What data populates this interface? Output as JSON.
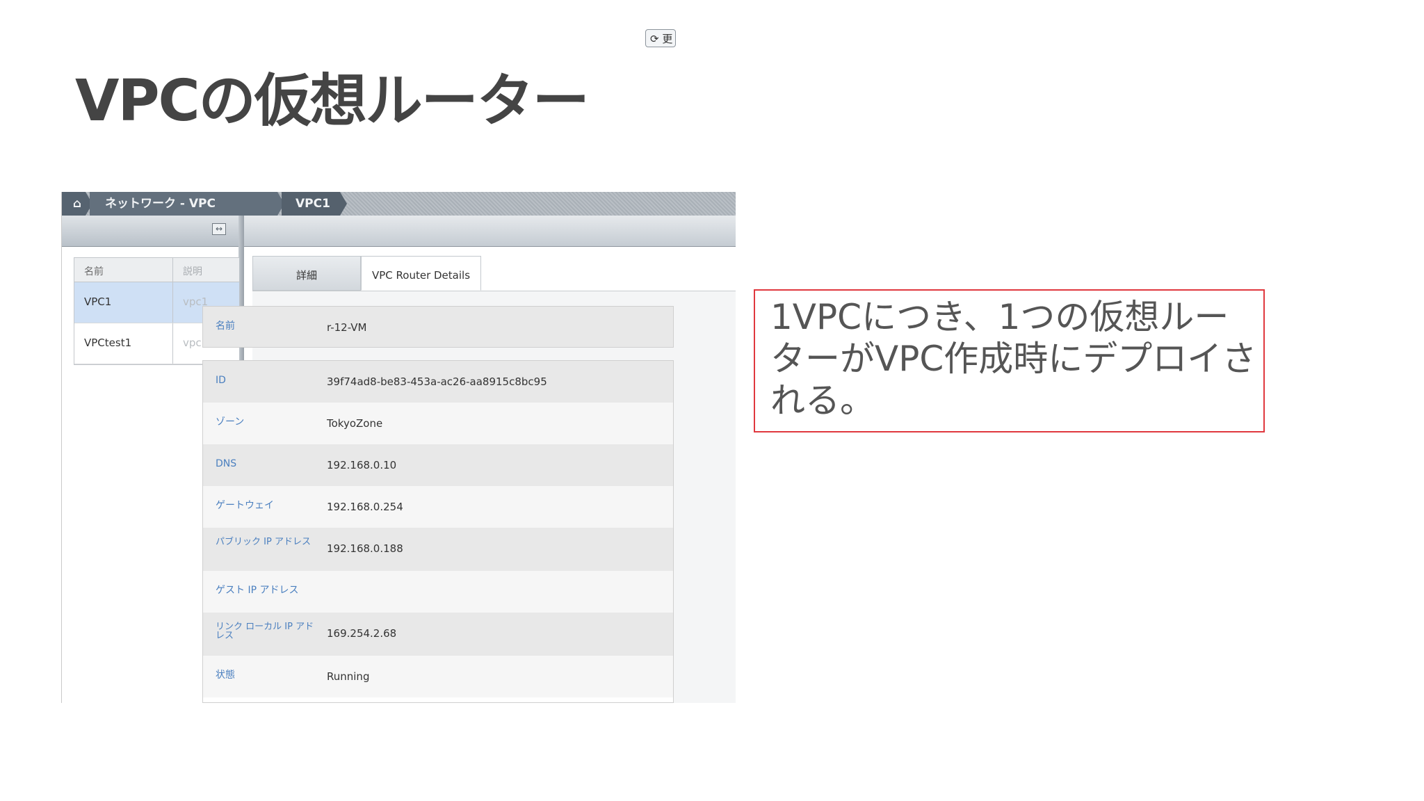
{
  "slide": {
    "title": "VPCの仮想ルーター"
  },
  "breadcrumb": {
    "home": "home-icon",
    "section": "ネットワーク - VPC",
    "current": "VPC1"
  },
  "toolbar": {
    "refresh_label": "更"
  },
  "list": {
    "headers": [
      "名前",
      "説明"
    ],
    "rows": [
      {
        "name": "VPC1",
        "desc": "vpc1",
        "selected": true
      },
      {
        "name": "VPCtest1",
        "desc": "vpc",
        "selected": false
      }
    ]
  },
  "tabs": [
    "詳細",
    "VPC Router Details"
  ],
  "details": {
    "name": {
      "label": "名前",
      "value": "r-12-VM"
    },
    "rows": [
      {
        "label": "ID",
        "value": "39f74ad8-be83-453a-ac26-aa8915c8bc95"
      },
      {
        "label": "ゾーン",
        "value": "TokyoZone"
      },
      {
        "label": "DNS",
        "value": "192.168.0.10"
      },
      {
        "label": "ゲートウェイ",
        "value": "192.168.0.254"
      },
      {
        "label": "パブリック IP アドレス",
        "value": "192.168.0.188"
      },
      {
        "label": "ゲスト IP アドレス",
        "value": ""
      },
      {
        "label": "リンク ローカル IP アドレス",
        "value": "169.254.2.68"
      },
      {
        "label": "状態",
        "value": "Running"
      }
    ]
  },
  "callout": {
    "text": "1VPCにつき、1つの仮想ルーターがVPC作成時にデプロイされる。"
  },
  "colors": {
    "accent_border": "#e0383e",
    "label_blue": "#4a7fbf",
    "selected_row": "#cfe0f5"
  }
}
